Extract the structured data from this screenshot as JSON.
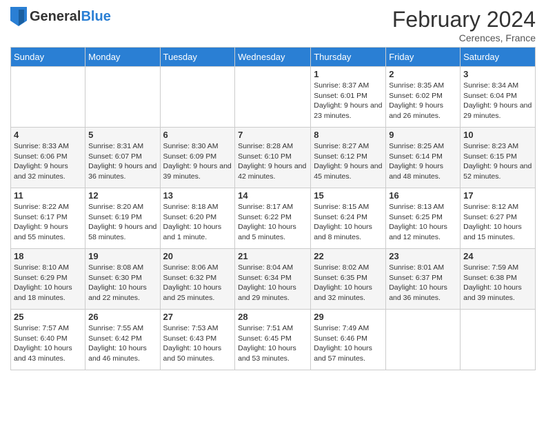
{
  "header": {
    "logo_general": "General",
    "logo_blue": "Blue",
    "month_title": "February 2024",
    "location": "Cerences, France"
  },
  "weekdays": [
    "Sunday",
    "Monday",
    "Tuesday",
    "Wednesday",
    "Thursday",
    "Friday",
    "Saturday"
  ],
  "weeks": [
    [
      null,
      null,
      null,
      null,
      {
        "day": "1",
        "sunrise": "Sunrise: 8:37 AM",
        "sunset": "Sunset: 6:01 PM",
        "daylight": "Daylight: 9 hours and 23 minutes."
      },
      {
        "day": "2",
        "sunrise": "Sunrise: 8:35 AM",
        "sunset": "Sunset: 6:02 PM",
        "daylight": "Daylight: 9 hours and 26 minutes."
      },
      {
        "day": "3",
        "sunrise": "Sunrise: 8:34 AM",
        "sunset": "Sunset: 6:04 PM",
        "daylight": "Daylight: 9 hours and 29 minutes."
      }
    ],
    [
      {
        "day": "4",
        "sunrise": "Sunrise: 8:33 AM",
        "sunset": "Sunset: 6:06 PM",
        "daylight": "Daylight: 9 hours and 32 minutes."
      },
      {
        "day": "5",
        "sunrise": "Sunrise: 8:31 AM",
        "sunset": "Sunset: 6:07 PM",
        "daylight": "Daylight: 9 hours and 36 minutes."
      },
      {
        "day": "6",
        "sunrise": "Sunrise: 8:30 AM",
        "sunset": "Sunset: 6:09 PM",
        "daylight": "Daylight: 9 hours and 39 minutes."
      },
      {
        "day": "7",
        "sunrise": "Sunrise: 8:28 AM",
        "sunset": "Sunset: 6:10 PM",
        "daylight": "Daylight: 9 hours and 42 minutes."
      },
      {
        "day": "8",
        "sunrise": "Sunrise: 8:27 AM",
        "sunset": "Sunset: 6:12 PM",
        "daylight": "Daylight: 9 hours and 45 minutes."
      },
      {
        "day": "9",
        "sunrise": "Sunrise: 8:25 AM",
        "sunset": "Sunset: 6:14 PM",
        "daylight": "Daylight: 9 hours and 48 minutes."
      },
      {
        "day": "10",
        "sunrise": "Sunrise: 8:23 AM",
        "sunset": "Sunset: 6:15 PM",
        "daylight": "Daylight: 9 hours and 52 minutes."
      }
    ],
    [
      {
        "day": "11",
        "sunrise": "Sunrise: 8:22 AM",
        "sunset": "Sunset: 6:17 PM",
        "daylight": "Daylight: 9 hours and 55 minutes."
      },
      {
        "day": "12",
        "sunrise": "Sunrise: 8:20 AM",
        "sunset": "Sunset: 6:19 PM",
        "daylight": "Daylight: 9 hours and 58 minutes."
      },
      {
        "day": "13",
        "sunrise": "Sunrise: 8:18 AM",
        "sunset": "Sunset: 6:20 PM",
        "daylight": "Daylight: 10 hours and 1 minute."
      },
      {
        "day": "14",
        "sunrise": "Sunrise: 8:17 AM",
        "sunset": "Sunset: 6:22 PM",
        "daylight": "Daylight: 10 hours and 5 minutes."
      },
      {
        "day": "15",
        "sunrise": "Sunrise: 8:15 AM",
        "sunset": "Sunset: 6:24 PM",
        "daylight": "Daylight: 10 hours and 8 minutes."
      },
      {
        "day": "16",
        "sunrise": "Sunrise: 8:13 AM",
        "sunset": "Sunset: 6:25 PM",
        "daylight": "Daylight: 10 hours and 12 minutes."
      },
      {
        "day": "17",
        "sunrise": "Sunrise: 8:12 AM",
        "sunset": "Sunset: 6:27 PM",
        "daylight": "Daylight: 10 hours and 15 minutes."
      }
    ],
    [
      {
        "day": "18",
        "sunrise": "Sunrise: 8:10 AM",
        "sunset": "Sunset: 6:29 PM",
        "daylight": "Daylight: 10 hours and 18 minutes."
      },
      {
        "day": "19",
        "sunrise": "Sunrise: 8:08 AM",
        "sunset": "Sunset: 6:30 PM",
        "daylight": "Daylight: 10 hours and 22 minutes."
      },
      {
        "day": "20",
        "sunrise": "Sunrise: 8:06 AM",
        "sunset": "Sunset: 6:32 PM",
        "daylight": "Daylight: 10 hours and 25 minutes."
      },
      {
        "day": "21",
        "sunrise": "Sunrise: 8:04 AM",
        "sunset": "Sunset: 6:34 PM",
        "daylight": "Daylight: 10 hours and 29 minutes."
      },
      {
        "day": "22",
        "sunrise": "Sunrise: 8:02 AM",
        "sunset": "Sunset: 6:35 PM",
        "daylight": "Daylight: 10 hours and 32 minutes."
      },
      {
        "day": "23",
        "sunrise": "Sunrise: 8:01 AM",
        "sunset": "Sunset: 6:37 PM",
        "daylight": "Daylight: 10 hours and 36 minutes."
      },
      {
        "day": "24",
        "sunrise": "Sunrise: 7:59 AM",
        "sunset": "Sunset: 6:38 PM",
        "daylight": "Daylight: 10 hours and 39 minutes."
      }
    ],
    [
      {
        "day": "25",
        "sunrise": "Sunrise: 7:57 AM",
        "sunset": "Sunset: 6:40 PM",
        "daylight": "Daylight: 10 hours and 43 minutes."
      },
      {
        "day": "26",
        "sunrise": "Sunrise: 7:55 AM",
        "sunset": "Sunset: 6:42 PM",
        "daylight": "Daylight: 10 hours and 46 minutes."
      },
      {
        "day": "27",
        "sunrise": "Sunrise: 7:53 AM",
        "sunset": "Sunset: 6:43 PM",
        "daylight": "Daylight: 10 hours and 50 minutes."
      },
      {
        "day": "28",
        "sunrise": "Sunrise: 7:51 AM",
        "sunset": "Sunset: 6:45 PM",
        "daylight": "Daylight: 10 hours and 53 minutes."
      },
      {
        "day": "29",
        "sunrise": "Sunrise: 7:49 AM",
        "sunset": "Sunset: 6:46 PM",
        "daylight": "Daylight: 10 hours and 57 minutes."
      },
      null,
      null
    ]
  ]
}
